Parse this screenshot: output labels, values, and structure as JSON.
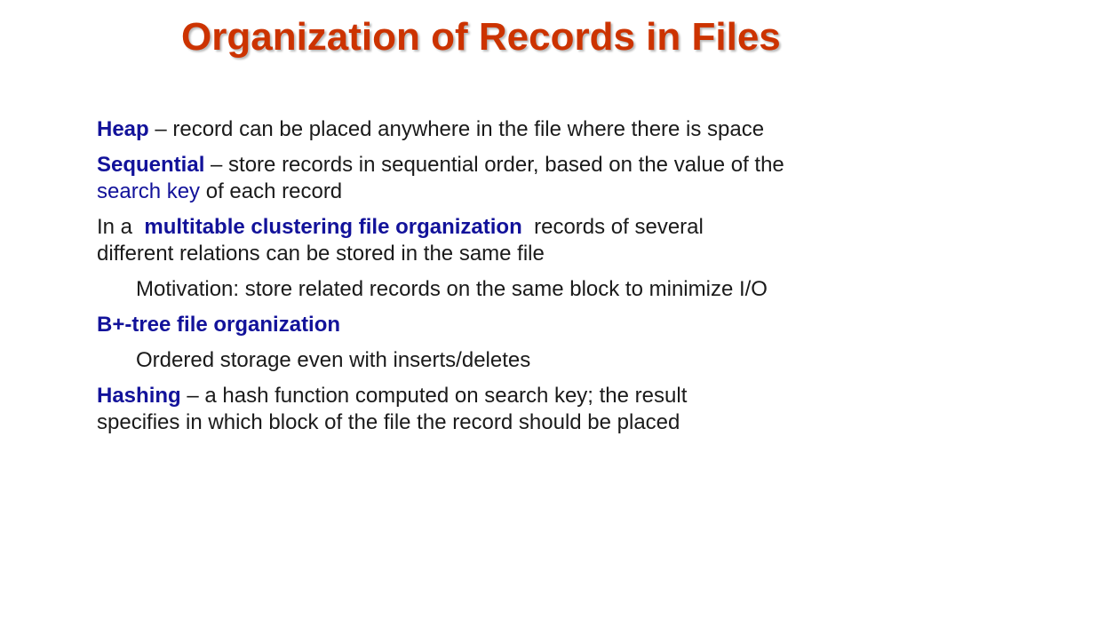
{
  "title": "Organization of Records in Files",
  "colors": {
    "title": "#cc3300",
    "keyword": "#12129a",
    "text": "#1a1a1a"
  },
  "bullets": {
    "heap": {
      "keyword": "Heap",
      "text": " – record can be placed anywhere in the file where there is space"
    },
    "sequential": {
      "keyword": "Sequential",
      "text1": " – store records in sequential order, based on the value of the ",
      "term": "search key",
      "text2": " of each record"
    },
    "multitable": {
      "prefix": "In a  ",
      "keyword": "multitable clustering file organization",
      "text": "  records of several different relations can be stored in the same file"
    },
    "motivation": {
      "text": "Motivation: store related records on the same block to minimize I/O"
    },
    "bplus": {
      "keyword": "B+-tree file organization"
    },
    "ordered": {
      "text": "Ordered storage even with inserts/deletes"
    },
    "hashing": {
      "keyword": "Hashing",
      "text": " – a hash function computed on search key; the result specifies in which block of the file the record should be placed"
    }
  }
}
